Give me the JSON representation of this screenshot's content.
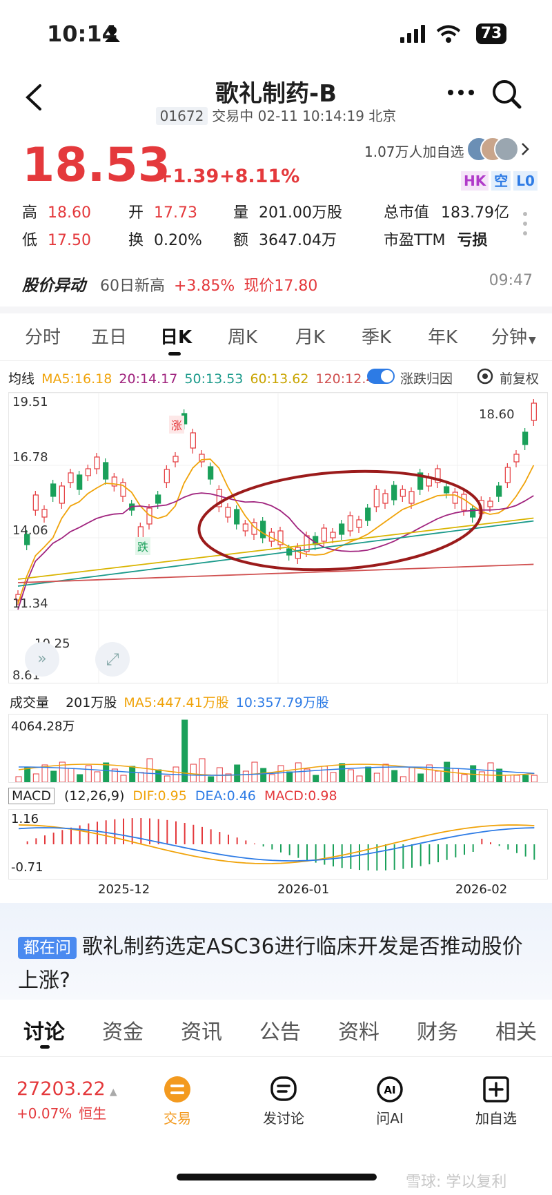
{
  "status": {
    "time": "10:14",
    "battery": "73"
  },
  "header": {
    "title": "歌礼制药-B",
    "code": "01672",
    "status_line": "交易中 02-11 10:14:19 北京"
  },
  "quote": {
    "price": "18.53",
    "change": "+1.39",
    "change_pct": "+8.11%",
    "watchers": "1.07万人加自选",
    "badges": [
      "HK",
      "空",
      "L0"
    ],
    "stats": [
      {
        "label": "高",
        "value": "18.60"
      },
      {
        "label": "开",
        "value": "17.73"
      },
      {
        "label": "量",
        "value": "201.00万股"
      },
      {
        "label": "总市值",
        "value": "183.79亿"
      },
      {
        "label": "低",
        "value": "17.50"
      },
      {
        "label": "换",
        "value": "0.20%"
      },
      {
        "label": "额",
        "value": "3647.04万"
      },
      {
        "label": "市盈TTM",
        "value": "亏损"
      }
    ]
  },
  "alert": {
    "title": "股价异动",
    "desc": "60日新高",
    "pct": "+3.85%",
    "now": "现价17.80",
    "time": "09:47"
  },
  "period_tabs": [
    "分时",
    "五日",
    "日K",
    "周K",
    "月K",
    "季K",
    "年K",
    "分钟"
  ],
  "active_period": "日K",
  "ma": {
    "label": "均线",
    "ma5": "MA5:16.18",
    "ma20": "20:14.17",
    "ma50": "50:13.53",
    "ma60": "60:13.62",
    "ma120": "120:12.44",
    "toggle_label": "涨跌归因",
    "adjust_label": "前复权"
  },
  "kchart": {
    "y_top": "19.51",
    "y_q1": "16.78",
    "y_mid": "14.06",
    "y_q3": "11.34",
    "y_bottom": "8.61",
    "high_marker": "18.60",
    "low_marker": "10.25",
    "tag_up": "涨",
    "tag_down": "跌"
  },
  "volume": {
    "label": "成交量",
    "value": "201万股",
    "ma5": "MA5:447.41万股",
    "ma10": "10:357.79万股",
    "max": "4064.28万"
  },
  "macd": {
    "label": "MACD",
    "params": "(12,26,9)",
    "dif": "DIF:0.95",
    "dea": "DEA:0.46",
    "macd": "MACD:0.98",
    "y_top": "1.16",
    "y_bottom": "-0.71"
  },
  "x_labels": [
    "2025-12",
    "2026-01",
    "2026-02"
  ],
  "question": {
    "tag": "都在问",
    "text": "歌礼制药选定ASC36进行临床开发是否推动股价上涨?"
  },
  "bottom_tabs": [
    "讨论",
    "资金",
    "资讯",
    "公告",
    "资料",
    "财务",
    "相关"
  ],
  "index": {
    "value": "27203.22",
    "change": "+0.07%",
    "name": "恒生"
  },
  "nav": [
    "交易",
    "发讨论",
    "问AI",
    "加自选"
  ],
  "watermark": "雪球: 学以复利",
  "colors": {
    "up": "#e4393c",
    "down": "#1aa05a",
    "ma5": "#f0a30a",
    "ma20": "#a0237e",
    "ma50": "#1a9a8a",
    "ma60": "#d9b400",
    "ma120": "#d05050"
  }
}
